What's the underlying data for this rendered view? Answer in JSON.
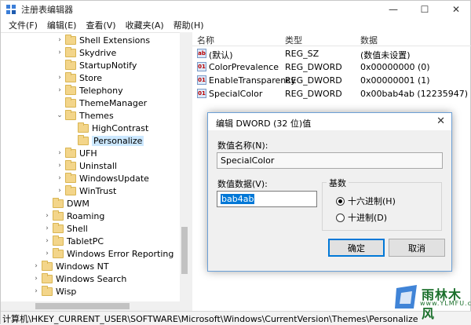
{
  "window": {
    "title": "注册表编辑器",
    "controls": [
      "—",
      "☐",
      "✕"
    ]
  },
  "menu": [
    "文件(F)",
    "编辑(E)",
    "查看(V)",
    "收藏夹(A)",
    "帮助(H)"
  ],
  "tree": [
    {
      "label": "Shell Extensions",
      "chevron": "›",
      "level": 3
    },
    {
      "label": "Skydrive",
      "chevron": "›",
      "level": 3
    },
    {
      "label": "StartupNotify",
      "chevron": "",
      "level": 3
    },
    {
      "label": "Store",
      "chevron": "›",
      "level": 3
    },
    {
      "label": "Telephony",
      "chevron": "›",
      "level": 3
    },
    {
      "label": "ThemeManager",
      "chevron": "",
      "level": 3
    },
    {
      "label": "Themes",
      "chevron": "⌄",
      "level": 3
    },
    {
      "label": "HighContrast",
      "chevron": "",
      "level": 4
    },
    {
      "label": "Personalize",
      "chevron": "",
      "level": 4,
      "selected": true
    },
    {
      "label": "UFH",
      "chevron": "›",
      "level": 3
    },
    {
      "label": "Uninstall",
      "chevron": "›",
      "level": 3
    },
    {
      "label": "WindowsUpdate",
      "chevron": "›",
      "level": 3
    },
    {
      "label": "WinTrust",
      "chevron": "›",
      "level": 3
    },
    {
      "label": "DWM",
      "chevron": "",
      "level": 2
    },
    {
      "label": "Roaming",
      "chevron": "›",
      "level": 2
    },
    {
      "label": "Shell",
      "chevron": "›",
      "level": 2
    },
    {
      "label": "TabletPC",
      "chevron": "›",
      "level": 2
    },
    {
      "label": "Windows Error Reporting",
      "chevron": "›",
      "level": 2
    },
    {
      "label": "Windows NT",
      "chevron": "›",
      "level": 1
    },
    {
      "label": "Windows Search",
      "chevron": "›",
      "level": 1
    },
    {
      "label": "Wisp",
      "chevron": "›",
      "level": 1
    }
  ],
  "list": {
    "headers": [
      "名称",
      "类型",
      "数据"
    ],
    "rows": [
      {
        "icon": "ab",
        "name": "(默认)",
        "type": "REG_SZ",
        "data": "(数值未设置)"
      },
      {
        "icon": "01",
        "name": "ColorPrevalence",
        "type": "REG_DWORD",
        "data": "0x00000000 (0)"
      },
      {
        "icon": "01",
        "name": "EnableTransparency",
        "type": "REG_DWORD",
        "data": "0x00000001 (1)"
      },
      {
        "icon": "01",
        "name": "SpecialColor",
        "type": "REG_DWORD",
        "data": "0x00bab4ab (12235947)"
      }
    ]
  },
  "dialog": {
    "title": "编辑 DWORD (32 位)值",
    "close": "✕",
    "name_label": "数值名称(N):",
    "name_value": "SpecialColor",
    "data_label": "数值数据(V):",
    "data_value": "bab4ab",
    "base_label": "基数",
    "radio_hex": "十六进制(H)",
    "radio_dec": "十进制(D)",
    "ok": "确定",
    "cancel": "取消"
  },
  "status": "计算机\\HKEY_CURRENT_USER\\SOFTWARE\\Microsoft\\Windows\\CurrentVersion\\Themes\\Personalize",
  "watermark": {
    "text": "雨林木风",
    "url": "www.YLMFU.com"
  }
}
